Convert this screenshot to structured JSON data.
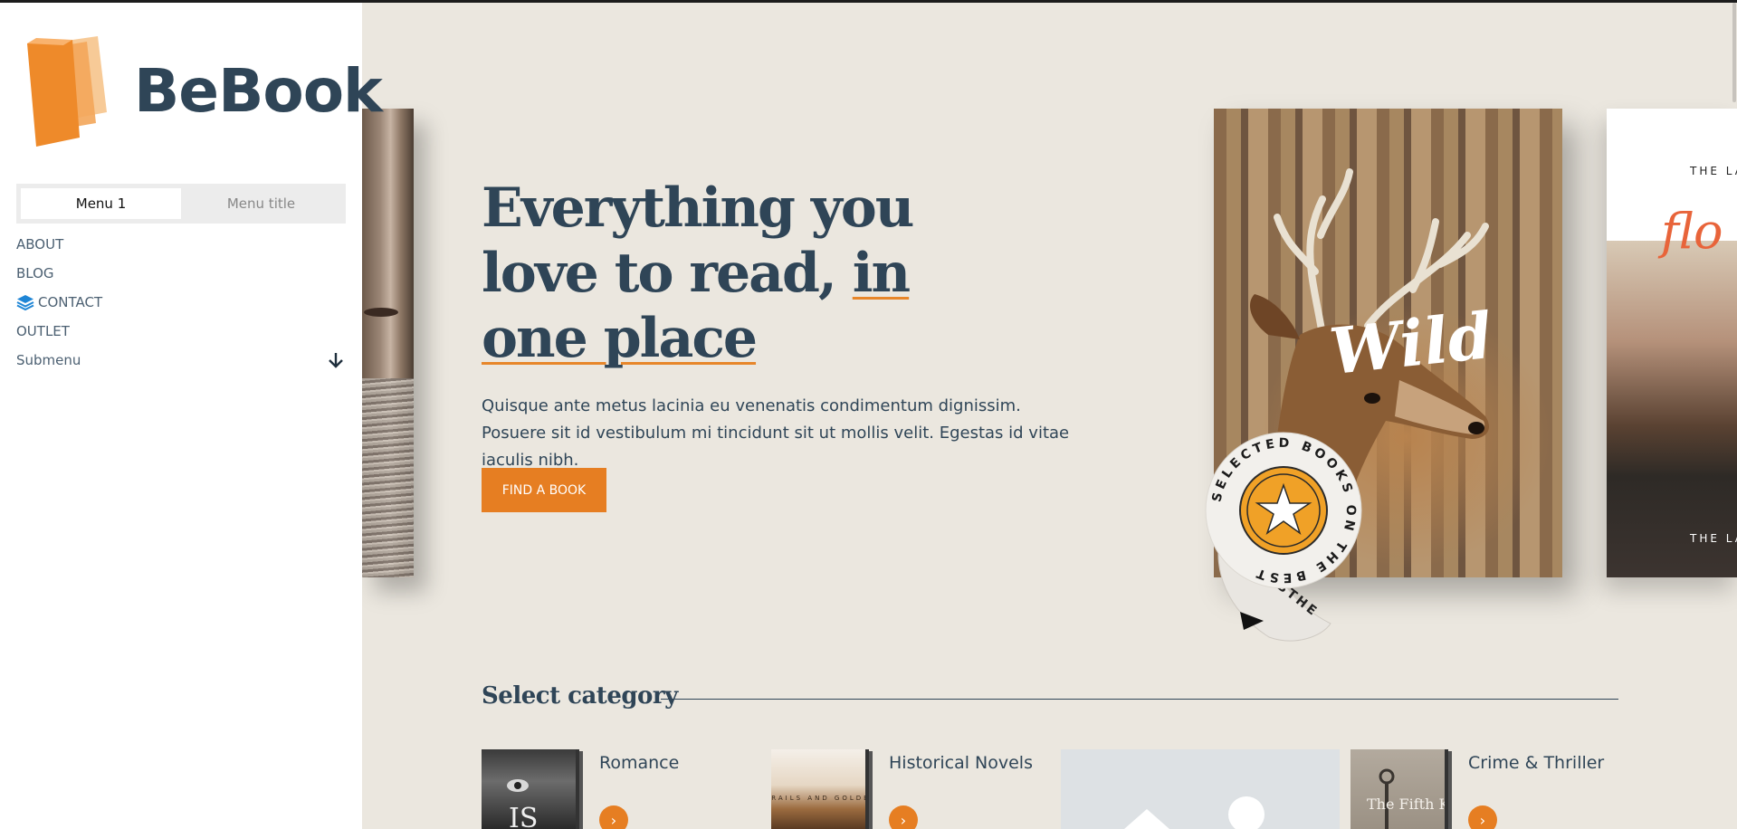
{
  "brand": {
    "name": "BeBook"
  },
  "sidebar": {
    "tabs": [
      {
        "label": "Menu 1",
        "active": true
      },
      {
        "label": "Menu title",
        "active": false
      }
    ],
    "items": [
      {
        "label": "ABOUT"
      },
      {
        "label": "BLOG"
      },
      {
        "label": "CONTACT",
        "icon": "layers-icon"
      },
      {
        "label": "OUTLET"
      },
      {
        "label": "Submenu",
        "icon": "arrow-down-icon"
      }
    ]
  },
  "hero": {
    "title_line1": "Everything you",
    "title_line2_a": "love to read, ",
    "title_line2_b": "in",
    "title_line3": "one place",
    "text": "Quisque ante metus lacinia eu venenatis condimentum dignissim. Posuere sit id vestibulum mi tincidunt sit ut mollis velit. Egestas id vitae iaculis nibh.",
    "cta": "FIND A BOOK",
    "featured_title": "Wild",
    "badge_text": "SELECTED BOOKS ON THE BEST",
    "badge_text_curl": "BTHE",
    "right_book_top": "THE LA",
    "right_book_script": "flo",
    "right_book_bottom": "THE LA"
  },
  "categories": {
    "heading": "Select category",
    "items": [
      {
        "name": "Romance",
        "go": "›"
      },
      {
        "name": "Historical Novels",
        "go": "›"
      },
      {
        "name": "Crime & Thriller",
        "go": "›"
      }
    ],
    "thumb_texts": {
      "romance": "IS",
      "historical": "DESERT TRAILS AND GOLDEN OASES",
      "crime": "The Fifth Key"
    }
  },
  "colors": {
    "accent": "#e67e22",
    "navy": "#2f4557",
    "background": "#ebe7df",
    "sidebar": "#ffffff"
  }
}
